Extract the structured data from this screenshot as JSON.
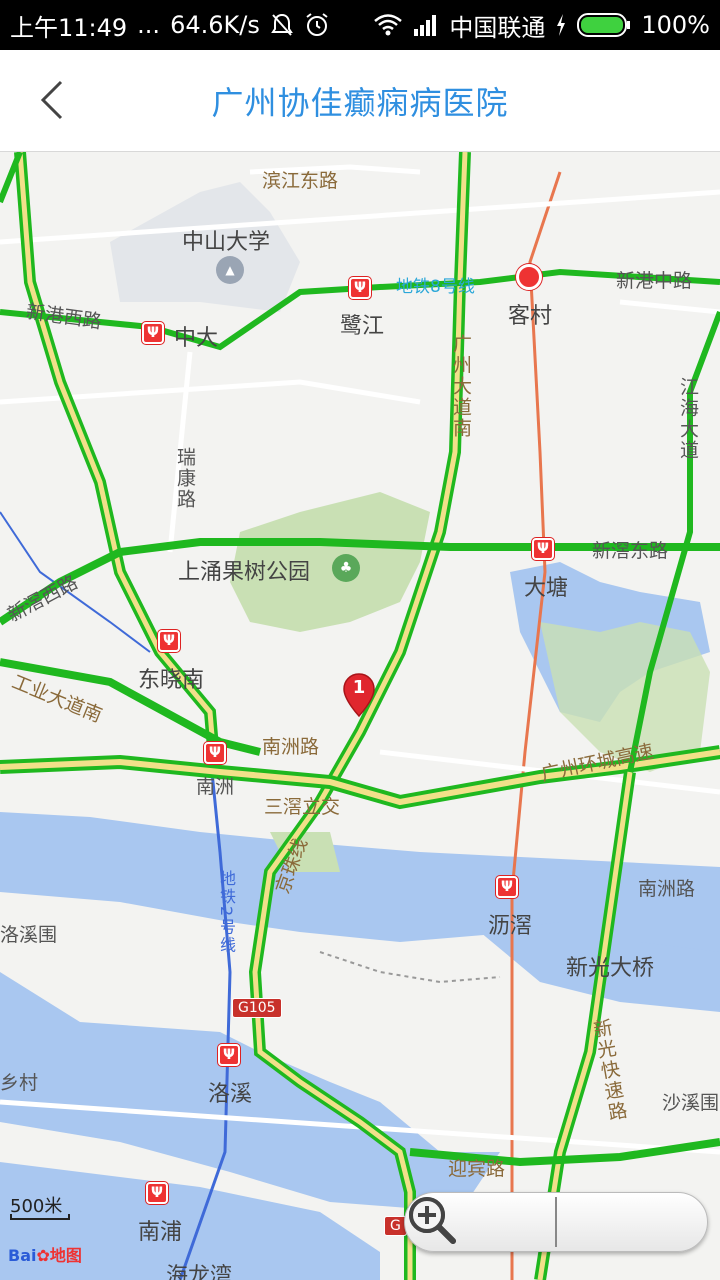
{
  "status_bar": {
    "time": "上午11:49",
    "dots": "...",
    "speed": "64.6K/s",
    "carrier": "中国联通",
    "battery": "100%"
  },
  "header": {
    "title": "广州协佳癫痫病医院"
  },
  "map": {
    "places": {
      "binjiang_road": "滨江东路",
      "sysu": "中山大学",
      "xingang_west": "新港西路",
      "zhongda": "中大",
      "lujiang": "鹭江",
      "metro_line8": "地铁8号线",
      "kecun": "客村",
      "xingang_middle": "新港中路",
      "guangzhou_avenue": "广州大道南",
      "jianghai_avenue": "江海大道",
      "ruikang_road": "瑞康路",
      "shangyong_park": "上涌果树公园",
      "xinjiao_east": "新滘东路",
      "datang": "大塘",
      "xinjiao_west": "新滘西路",
      "dongxiaonan": "东晓南",
      "gongye_avenue": "工业大道南",
      "nanzhou_road": "南洲路",
      "nanzhou_station": "南洲",
      "sanjiao_interchange": "三滘立交",
      "jingzhu_line": "京珠线",
      "ring_expressway": "广州环城高速",
      "nanzhou_road_east": "南洲路",
      "metro_line2": "地铁2号线",
      "luoxi_wai": "洛溪围",
      "lijiao": "沥滘",
      "xinguang_bridge": "新光大桥",
      "g105": "G105",
      "luoxi": "洛溪",
      "xinguang_expressway": "新光快速路",
      "xiang_village": "乡村",
      "shaxiwei": "沙溪围",
      "yingbin_road": "迎宾路",
      "nanpu": "南浦",
      "hailongwan": "海龙湾",
      "g_partial": "G"
    },
    "marker_label": "1",
    "scale_label": "500米",
    "logo_text": "Bai",
    "logo_suffix": "地图",
    "zoom_out_icon": "zoom-out-icon",
    "zoom_in_icon": "zoom-in-icon"
  },
  "colors": {
    "title": "#2f8fe0",
    "road_green": "#1fb81f",
    "road_yellow": "#f1e08a",
    "water": "#a9c7f0",
    "park": "#c9e0b4",
    "metro": "#e33333",
    "rail": "#e8764e"
  }
}
